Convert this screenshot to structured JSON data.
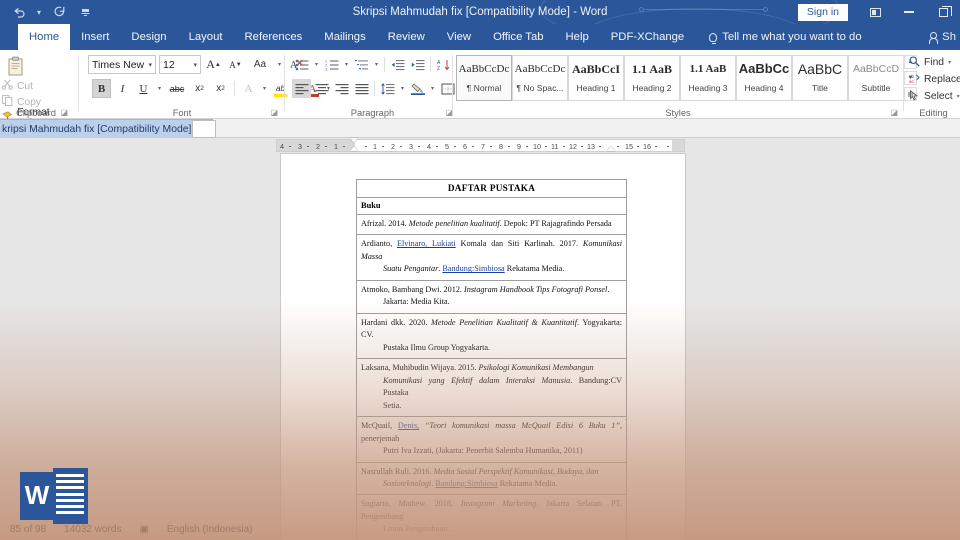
{
  "window": {
    "title": "Skripsi Mahmudah fix [Compatibility Mode]  -  Word",
    "signin": "Sign in",
    "ribbon_display_icon": "ribbon-display-options-icon",
    "minimize_icon": "minimize-icon",
    "restore_icon": "restore-icon"
  },
  "qat": {
    "undo": "undo-icon",
    "undo_caret": "chevron-down-icon",
    "redo": "redo-icon",
    "customize": "customize-quick-access-toolbar-icon"
  },
  "tabs": [
    {
      "label": "Home",
      "active": true
    },
    {
      "label": "Insert",
      "active": false
    },
    {
      "label": "Design",
      "active": false
    },
    {
      "label": "Layout",
      "active": false
    },
    {
      "label": "References",
      "active": false
    },
    {
      "label": "Mailings",
      "active": false
    },
    {
      "label": "Review",
      "active": false
    },
    {
      "label": "View",
      "active": false
    },
    {
      "label": "Office Tab",
      "active": false
    },
    {
      "label": "Help",
      "active": false
    },
    {
      "label": "PDF-XChange",
      "active": false
    }
  ],
  "tellme": {
    "placeholder": "Tell me what you want to do"
  },
  "share": {
    "label": "Sh"
  },
  "ribbon": {
    "clipboard": {
      "group_label": "Clipboard",
      "paste_label": "Paste",
      "cut_label": "Cut",
      "copy_label": "Copy",
      "format_painter_label": "Format Painter"
    },
    "font": {
      "group_label": "Font",
      "font_name": "Times New Ro",
      "font_size": "12",
      "grow_font": "A",
      "shrink_font": "A",
      "change_case": "Aa",
      "clear_formatting": "clear-formatting-icon",
      "bold": "B",
      "italic": "I",
      "underline": "U",
      "strikethrough": "abc",
      "subscript": "x",
      "superscript": "x",
      "text_effects": "A",
      "highlight": "ab",
      "font_color": "A"
    },
    "paragraph": {
      "group_label": "Paragraph",
      "bullets": "bullets-icon",
      "numbering": "numbering-icon",
      "multilevel": "multilevel-list-icon",
      "decrease_indent": "decrease-indent-icon",
      "increase_indent": "increase-indent-icon",
      "sort": "sort-icon",
      "show_marks": "¶",
      "align_left": "align-left-icon",
      "align_center": "align-center-icon",
      "align_right": "align-right-icon",
      "justify": "justify-icon",
      "line_spacing": "line-spacing-icon",
      "shading": "shading-icon",
      "borders": "borders-icon"
    },
    "styles": {
      "group_label": "Styles",
      "items": [
        {
          "sample": "AaBbCcDc",
          "name": "¶ Normal",
          "selected": true
        },
        {
          "sample": "AaBbCcDc",
          "name": "¶ No Spac...",
          "selected": false
        },
        {
          "sample": "AaBbCcI",
          "name": "Heading 1",
          "selected": false
        },
        {
          "sample": "1.1 AaB",
          "name": "Heading 2",
          "selected": false
        },
        {
          "sample": "1.1 AaB",
          "name": "Heading 3",
          "selected": false
        },
        {
          "sample": "AaBbCc",
          "name": "Heading 4",
          "selected": false
        },
        {
          "sample": "AaBbC",
          "name": "Title",
          "selected": false
        },
        {
          "sample": "AaBbCcD",
          "name": "Subtitle",
          "selected": false
        }
      ]
    },
    "editing": {
      "group_label": "Editing",
      "find_label": "Find",
      "replace_label": "Replace",
      "select_label": "Select"
    }
  },
  "doctab": {
    "label": "kripsi Mahmudah fix [Compatibility Mode]",
    "close_icon": "close-icon",
    "new_tab_icon": "new-tab-icon"
  },
  "ruler": {
    "labels_left": [
      "4",
      "3",
      "2",
      "1"
    ],
    "labels_right": [
      "1",
      "2",
      "3",
      "4",
      "5",
      "6",
      "7",
      "8",
      "9",
      "10",
      "11",
      "12",
      "13",
      "15",
      "16"
    ]
  },
  "document": {
    "title": "DAFTAR PUSTAKA",
    "section": "Buku",
    "entries": [
      {
        "id": "afrizal",
        "lines": [
          [
            {
              "t": "Afrizal. 2014. ",
              "s": "n"
            },
            {
              "t": "Metode penelitian kualitatif",
              "s": "i"
            },
            {
              "t": ". Depok: PT Rajagrafindo Persada",
              "s": "n"
            }
          ]
        ]
      },
      {
        "id": "ardianto",
        "lines": [
          [
            {
              "t": "Ardianto, ",
              "s": "n"
            },
            {
              "t": "Elvinaro, Lukiati",
              "s": "u"
            },
            {
              "t": " Komala dan Siti Karlinah. 2017. ",
              "s": "n"
            },
            {
              "t": "Komunikasi Massa",
              "s": "i"
            }
          ],
          [
            {
              "t": "Suatu Pengantar",
              "s": "i"
            },
            {
              "t": ". ",
              "s": "n"
            },
            {
              "t": "Bandung:Simbiosa",
              "s": "u"
            },
            {
              "t": " Rekatama Media.",
              "s": "n"
            }
          ]
        ]
      },
      {
        "id": "atmoko",
        "lines": [
          [
            {
              "t": "Atmoko, Bambang Dwi. 2012. ",
              "s": "n"
            },
            {
              "t": "Instagram Handbook Tips Fotografi Ponsel",
              "s": "i"
            },
            {
              "t": ".",
              "s": "n"
            }
          ],
          [
            {
              "t": "Jakarta: Media Kita.",
              "s": "n"
            }
          ]
        ]
      },
      {
        "id": "hardani",
        "lines": [
          [
            {
              "t": "Hardani dkk. 2020. ",
              "s": "n"
            },
            {
              "t": "Metode Penelitian Kualitatif & Kuantitatif",
              "s": "i"
            },
            {
              "t": ". Yogyakarta: CV.",
              "s": "n"
            }
          ],
          [
            {
              "t": "Pustaka Ilmu Group Yogyakarta.",
              "s": "n"
            }
          ]
        ]
      },
      {
        "id": "laksana",
        "lines": [
          [
            {
              "t": "Laksana, Muhibudin Wijaya. 2015. ",
              "s": "n"
            },
            {
              "t": "Psikologi Komunikasi Membangun",
              "s": "i"
            }
          ],
          [
            {
              "t": "Komunikasi yang Efektif dalam Interaksi Manusia",
              "s": "i"
            },
            {
              "t": ". Bandung:CV Pustaka",
              "s": "n"
            }
          ],
          [
            {
              "t": "Setia.",
              "s": "n"
            }
          ]
        ]
      },
      {
        "id": "mcquail",
        "lines": [
          [
            {
              "t": "McQuail, ",
              "s": "n"
            },
            {
              "t": "Denis,",
              "s": "u"
            },
            {
              "t": " “Teori komunikasi massa McQuail Edisi 6 Buku 1”",
              "s": "i"
            },
            {
              "t": ", penerjemah",
              "s": "n"
            }
          ],
          [
            {
              "t": "Putri Iva Izzati, (Jakarta: Penerbit Salemba Humanika, 2011)",
              "s": "n"
            }
          ]
        ]
      },
      {
        "id": "nasrullah",
        "lines": [
          [
            {
              "t": "Nasrullah Ruli. 2016. ",
              "s": "n"
            },
            {
              "t": "Media Sosial Perspektif Komunikasi, Budaya, dan",
              "s": "i"
            }
          ],
          [
            {
              "t": "Sosioteknologi",
              "s": "i"
            },
            {
              "t": ". ",
              "s": "n"
            },
            {
              "t": "Bandung:Simbiosa",
              "s": "u"
            },
            {
              "t": " Rekatama Media.",
              "s": "n"
            }
          ]
        ]
      },
      {
        "id": "sugiarto",
        "lines": [
          [
            {
              "t": "Sugiarto, Mathew. 2018. ",
              "s": "n"
            },
            {
              "t": "Instagram Marketing",
              "s": "i"
            },
            {
              "t": ". Jakarta Selatan: PT. Pengembang",
              "s": "n"
            }
          ],
          [
            {
              "t": "Lintas Pengetahuan.",
              "s": "n"
            }
          ]
        ]
      }
    ]
  },
  "statusbar": {
    "page": "85 of 98",
    "words": "14032 words",
    "proofing_icon": "proofing-errors-icon",
    "language": "English (Indonesia)"
  },
  "overlay": {
    "word_logo": "microsoft-word-logo",
    "logo_letter": "W"
  },
  "colors": {
    "word_blue": "#2b579a",
    "ribbon_bg": "#ffffff",
    "canvas": "#e6e6e6",
    "fade_tint": "#c4967d",
    "doctab_active": "#bdd0ea"
  }
}
